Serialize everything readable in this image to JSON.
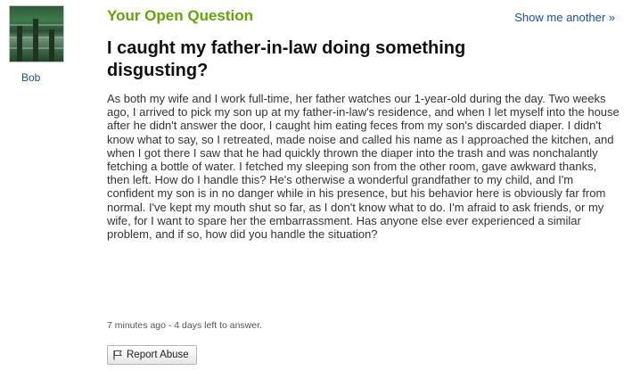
{
  "header": {
    "title": "Your Open Question",
    "show_another": "Show me another »"
  },
  "user": {
    "name": "Bob"
  },
  "question": {
    "title": "I caught my father-in-law doing something disgusting?",
    "body": "As both my wife and I work full-time, her father watches our 1-year-old during the day. Two weeks ago, I arrived to pick my son up at my father-in-law's residence, and when I let myself into the house after he didn't answer the door, I caught him eating feces from my son's discarded diaper. I didn't know what to say, so I retreated, made noise and called his name as I approached the kitchen, and when I got there I saw that he had quickly thrown the diaper into the trash and was nonchalantly fetching a bottle of water. I fetched my sleeping son from the other room, gave awkward thanks, then left. How do I handle this? He's otherwise a wonderful grandfather to my child, and I'm confident my son is in no danger while in his presence, but his behavior here is obviously far from normal. I've kept my mouth shut so far, as I don't know what to do. I'm afraid to ask friends, or my wife, for I want to spare her the embarrassment. Has anyone else ever experienced a similar problem, and if so, how did you handle the situation?",
    "meta": "7 minutes ago - 4 days left to answer."
  },
  "actions": {
    "report_abuse": "Report Abuse"
  },
  "colors": {
    "header_green": "#65a30d",
    "link_blue": "#1a4fa0"
  }
}
